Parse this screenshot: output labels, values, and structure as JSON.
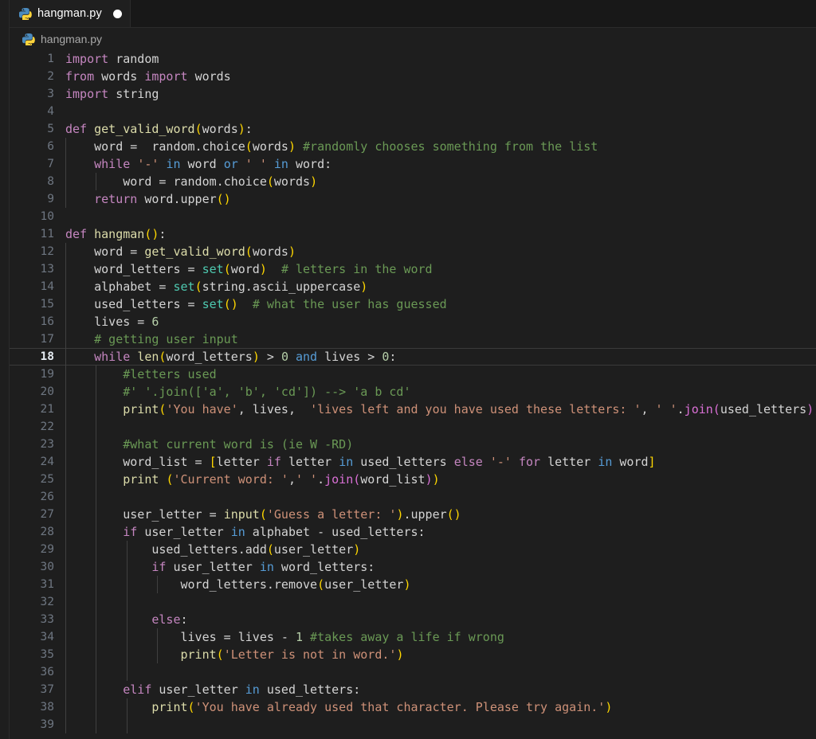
{
  "window": {
    "background": "#1e1e1e",
    "editor_background": "#1e1e1e",
    "tabbar_background": "#181818",
    "active_tab_background": "#1f1f1f"
  },
  "tabbar": {
    "tabs": [
      {
        "label": "hangman.py",
        "icon": "python-file-icon",
        "dirty": true,
        "active": true
      }
    ]
  },
  "breadcrumb": {
    "icon": "python-file-icon",
    "items": [
      "hangman.py"
    ]
  },
  "editor": {
    "language": "python",
    "active_line": 18,
    "first_visible_line": 1,
    "last_visible_line": 39,
    "theme_colors": {
      "keyword": "#c586c0",
      "control": "#569cd6",
      "function": "#dcdcaa",
      "builtin_type": "#4ec9b0",
      "string": "#ce9178",
      "comment": "#6a9955",
      "number": "#b5cea8",
      "variable": "#d4d4d4",
      "bracket_level_1": "#ffd700",
      "bracket_level_2": "#da70d6",
      "bracket_level_3": "#179fff",
      "line_number": "#6e7681",
      "active_line_number": "#e6edf3",
      "indent_guide": "#404040"
    },
    "lines": [
      {
        "n": 1,
        "indent": 0,
        "tokens": [
          [
            "t-kw",
            "import"
          ],
          [
            "t-op",
            " "
          ],
          [
            "t-var",
            "random"
          ]
        ]
      },
      {
        "n": 2,
        "indent": 0,
        "tokens": [
          [
            "t-kw",
            "from"
          ],
          [
            "t-op",
            " "
          ],
          [
            "t-var",
            "words"
          ],
          [
            "t-op",
            " "
          ],
          [
            "t-kw",
            "import"
          ],
          [
            "t-op",
            " "
          ],
          [
            "t-var",
            "words"
          ]
        ]
      },
      {
        "n": 3,
        "indent": 0,
        "tokens": [
          [
            "t-kw",
            "import"
          ],
          [
            "t-op",
            " "
          ],
          [
            "t-var",
            "string"
          ]
        ]
      },
      {
        "n": 4,
        "indent": 0,
        "tokens": []
      },
      {
        "n": 5,
        "indent": 0,
        "tokens": [
          [
            "t-kw",
            "def"
          ],
          [
            "t-op",
            " "
          ],
          [
            "t-fn",
            "get_valid_word"
          ],
          [
            "t-p0",
            "("
          ],
          [
            "t-var",
            "words"
          ],
          [
            "t-p0",
            ")"
          ],
          [
            "t-op",
            ":"
          ]
        ]
      },
      {
        "n": 6,
        "indent": 1,
        "tokens": [
          [
            "t-op",
            "    word =  "
          ],
          [
            "t-var",
            "random"
          ],
          [
            "t-op",
            "."
          ],
          [
            "t-var",
            "choice"
          ],
          [
            "t-p0",
            "("
          ],
          [
            "t-var",
            "words"
          ],
          [
            "t-p0",
            ")"
          ],
          [
            "t-op",
            " "
          ],
          [
            "t-cmt",
            "#randomly chooses something from the list"
          ]
        ]
      },
      {
        "n": 7,
        "indent": 1,
        "tokens": [
          [
            "t-op",
            "    "
          ],
          [
            "t-kw",
            "while"
          ],
          [
            "t-op",
            " "
          ],
          [
            "t-str",
            "'-'"
          ],
          [
            "t-op",
            " "
          ],
          [
            "t-ctrl",
            "in"
          ],
          [
            "t-op",
            " word "
          ],
          [
            "t-ctrl",
            "or"
          ],
          [
            "t-op",
            " "
          ],
          [
            "t-str",
            "' '"
          ],
          [
            "t-op",
            " "
          ],
          [
            "t-ctrl",
            "in"
          ],
          [
            "t-op",
            " word:"
          ]
        ]
      },
      {
        "n": 8,
        "indent": 2,
        "tokens": [
          [
            "t-op",
            "        word = "
          ],
          [
            "t-var",
            "random"
          ],
          [
            "t-op",
            "."
          ],
          [
            "t-var",
            "choice"
          ],
          [
            "t-p0",
            "("
          ],
          [
            "t-var",
            "words"
          ],
          [
            "t-p0",
            ")"
          ]
        ]
      },
      {
        "n": 9,
        "indent": 1,
        "tokens": [
          [
            "t-op",
            "    "
          ],
          [
            "t-kw",
            "return"
          ],
          [
            "t-op",
            " word."
          ],
          [
            "t-var",
            "upper"
          ],
          [
            "t-p0",
            "()"
          ]
        ]
      },
      {
        "n": 10,
        "indent": 0,
        "tokens": []
      },
      {
        "n": 11,
        "indent": 0,
        "tokens": [
          [
            "t-kw",
            "def"
          ],
          [
            "t-op",
            " "
          ],
          [
            "t-fn",
            "hangman"
          ],
          [
            "t-p0",
            "()"
          ],
          [
            "t-op",
            ":"
          ]
        ]
      },
      {
        "n": 12,
        "indent": 1,
        "tokens": [
          [
            "t-op",
            "    word = "
          ],
          [
            "t-fn",
            "get_valid_word"
          ],
          [
            "t-p0",
            "("
          ],
          [
            "t-var",
            "words"
          ],
          [
            "t-p0",
            ")"
          ]
        ]
      },
      {
        "n": 13,
        "indent": 1,
        "tokens": [
          [
            "t-op",
            "    word_letters = "
          ],
          [
            "t-builtin",
            "set"
          ],
          [
            "t-p0",
            "("
          ],
          [
            "t-var",
            "word"
          ],
          [
            "t-p0",
            ")"
          ],
          [
            "t-op",
            "  "
          ],
          [
            "t-cmt",
            "# letters in the word"
          ]
        ]
      },
      {
        "n": 14,
        "indent": 1,
        "tokens": [
          [
            "t-op",
            "    alphabet = "
          ],
          [
            "t-builtin",
            "set"
          ],
          [
            "t-p0",
            "("
          ],
          [
            "t-var",
            "string"
          ],
          [
            "t-op",
            "."
          ],
          [
            "t-var",
            "ascii_uppercase"
          ],
          [
            "t-p0",
            ")"
          ]
        ]
      },
      {
        "n": 15,
        "indent": 1,
        "tokens": [
          [
            "t-op",
            "    used_letters = "
          ],
          [
            "t-builtin",
            "set"
          ],
          [
            "t-p0",
            "()"
          ],
          [
            "t-op",
            "  "
          ],
          [
            "t-cmt",
            "# what the user has guessed"
          ]
        ]
      },
      {
        "n": 16,
        "indent": 1,
        "tokens": [
          [
            "t-op",
            "    lives = "
          ],
          [
            "t-num",
            "6"
          ]
        ]
      },
      {
        "n": 17,
        "indent": 1,
        "tokens": [
          [
            "t-op",
            "    "
          ],
          [
            "t-cmt",
            "# getting user input"
          ]
        ]
      },
      {
        "n": 18,
        "indent": 1,
        "active": true,
        "tokens": [
          [
            "t-op",
            "    "
          ],
          [
            "t-kw",
            "while"
          ],
          [
            "t-op",
            " "
          ],
          [
            "t-fn",
            "len"
          ],
          [
            "t-p0",
            "("
          ],
          [
            "t-var",
            "word_letters"
          ],
          [
            "t-p0",
            ")"
          ],
          [
            "t-op",
            " > "
          ],
          [
            "t-num",
            "0"
          ],
          [
            "t-op",
            " "
          ],
          [
            "t-ctrl",
            "and"
          ],
          [
            "t-op",
            " lives > "
          ],
          [
            "t-num",
            "0"
          ],
          [
            "t-op",
            ":"
          ]
        ]
      },
      {
        "n": 19,
        "indent": 2,
        "tokens": [
          [
            "t-op",
            "        "
          ],
          [
            "t-cmt",
            "#letters used"
          ]
        ]
      },
      {
        "n": 20,
        "indent": 2,
        "tokens": [
          [
            "t-op",
            "        "
          ],
          [
            "t-cmt",
            "#' '.join(['a', 'b', 'cd']) --> 'a b cd'"
          ]
        ]
      },
      {
        "n": 21,
        "indent": 2,
        "tokens": [
          [
            "t-op",
            "        "
          ],
          [
            "t-fn",
            "print"
          ],
          [
            "t-p0",
            "("
          ],
          [
            "t-str",
            "'You have'"
          ],
          [
            "t-op",
            ", lives,  "
          ],
          [
            "t-str",
            "'lives left and you have used these letters: '"
          ],
          [
            "t-op",
            ", "
          ],
          [
            "t-str",
            "' '"
          ],
          [
            "t-op",
            "."
          ],
          [
            "t-p1",
            "join"
          ],
          [
            "t-p1",
            "("
          ],
          [
            "t-var",
            "used_letters"
          ],
          [
            "t-p1",
            ")"
          ],
          [
            "t-p0",
            ")"
          ]
        ]
      },
      {
        "n": 22,
        "indent": 2,
        "tokens": []
      },
      {
        "n": 23,
        "indent": 2,
        "tokens": [
          [
            "t-op",
            "        "
          ],
          [
            "t-cmt",
            "#what current word is (ie W -RD)"
          ]
        ]
      },
      {
        "n": 24,
        "indent": 2,
        "tokens": [
          [
            "t-op",
            "        word_list = "
          ],
          [
            "t-p0",
            "["
          ],
          [
            "t-var",
            "letter"
          ],
          [
            "t-op",
            " "
          ],
          [
            "t-kw",
            "if"
          ],
          [
            "t-op",
            " letter "
          ],
          [
            "t-ctrl",
            "in"
          ],
          [
            "t-op",
            " used_letters "
          ],
          [
            "t-kw",
            "else"
          ],
          [
            "t-op",
            " "
          ],
          [
            "t-str",
            "'-'"
          ],
          [
            "t-op",
            " "
          ],
          [
            "t-kw",
            "for"
          ],
          [
            "t-op",
            " letter "
          ],
          [
            "t-ctrl",
            "in"
          ],
          [
            "t-op",
            " word"
          ],
          [
            "t-p0",
            "]"
          ]
        ]
      },
      {
        "n": 25,
        "indent": 2,
        "tokens": [
          [
            "t-op",
            "        "
          ],
          [
            "t-fn",
            "print"
          ],
          [
            "t-op",
            " "
          ],
          [
            "t-p0",
            "("
          ],
          [
            "t-str",
            "'Current word: '"
          ],
          [
            "t-op",
            ","
          ],
          [
            "t-str",
            "' '"
          ],
          [
            "t-op",
            "."
          ],
          [
            "t-p1",
            "join"
          ],
          [
            "t-p1",
            "("
          ],
          [
            "t-var",
            "word_list"
          ],
          [
            "t-p1",
            ")"
          ],
          [
            "t-p0",
            ")"
          ]
        ]
      },
      {
        "n": 26,
        "indent": 2,
        "tokens": []
      },
      {
        "n": 27,
        "indent": 2,
        "tokens": [
          [
            "t-op",
            "        user_letter = "
          ],
          [
            "t-fn",
            "input"
          ],
          [
            "t-p0",
            "("
          ],
          [
            "t-str",
            "'Guess a letter: '"
          ],
          [
            "t-p0",
            ")"
          ],
          [
            "t-op",
            "."
          ],
          [
            "t-var",
            "upper"
          ],
          [
            "t-p0",
            "()"
          ]
        ]
      },
      {
        "n": 28,
        "indent": 2,
        "tokens": [
          [
            "t-op",
            "        "
          ],
          [
            "t-kw",
            "if"
          ],
          [
            "t-op",
            " user_letter "
          ],
          [
            "t-ctrl",
            "in"
          ],
          [
            "t-op",
            " alphabet - used_letters:"
          ]
        ]
      },
      {
        "n": 29,
        "indent": 3,
        "tokens": [
          [
            "t-op",
            "            used_letters."
          ],
          [
            "t-var",
            "add"
          ],
          [
            "t-p0",
            "("
          ],
          [
            "t-var",
            "user_letter"
          ],
          [
            "t-p0",
            ")"
          ]
        ]
      },
      {
        "n": 30,
        "indent": 3,
        "tokens": [
          [
            "t-op",
            "            "
          ],
          [
            "t-kw",
            "if"
          ],
          [
            "t-op",
            " user_letter "
          ],
          [
            "t-ctrl",
            "in"
          ],
          [
            "t-op",
            " word_letters:"
          ]
        ]
      },
      {
        "n": 31,
        "indent": 4,
        "tokens": [
          [
            "t-op",
            "                word_letters."
          ],
          [
            "t-var",
            "remove"
          ],
          [
            "t-p0",
            "("
          ],
          [
            "t-var",
            "user_letter"
          ],
          [
            "t-p0",
            ")"
          ]
        ]
      },
      {
        "n": 32,
        "indent": 3,
        "tokens": []
      },
      {
        "n": 33,
        "indent": 3,
        "tokens": [
          [
            "t-op",
            "            "
          ],
          [
            "t-kw",
            "else"
          ],
          [
            "t-op",
            ":"
          ]
        ]
      },
      {
        "n": 34,
        "indent": 4,
        "tokens": [
          [
            "t-op",
            "                lives = lives - "
          ],
          [
            "t-num",
            "1"
          ],
          [
            "t-op",
            " "
          ],
          [
            "t-cmt",
            "#takes away a life if wrong"
          ]
        ]
      },
      {
        "n": 35,
        "indent": 4,
        "tokens": [
          [
            "t-op",
            "                "
          ],
          [
            "t-fn",
            "print"
          ],
          [
            "t-p0",
            "("
          ],
          [
            "t-str",
            "'Letter is not in word.'"
          ],
          [
            "t-p0",
            ")"
          ]
        ]
      },
      {
        "n": 36,
        "indent": 3,
        "tokens": []
      },
      {
        "n": 37,
        "indent": 2,
        "tokens": [
          [
            "t-op",
            "        "
          ],
          [
            "t-kw",
            "elif"
          ],
          [
            "t-op",
            " user_letter "
          ],
          [
            "t-ctrl",
            "in"
          ],
          [
            "t-op",
            " used_letters:"
          ]
        ]
      },
      {
        "n": 38,
        "indent": 3,
        "tokens": [
          [
            "t-op",
            "            "
          ],
          [
            "t-fn",
            "print"
          ],
          [
            "t-p0",
            "("
          ],
          [
            "t-str",
            "'You have already used that character. Please try again.'"
          ],
          [
            "t-p0",
            ")"
          ]
        ]
      },
      {
        "n": 39,
        "indent": 3,
        "tokens": []
      }
    ]
  }
}
